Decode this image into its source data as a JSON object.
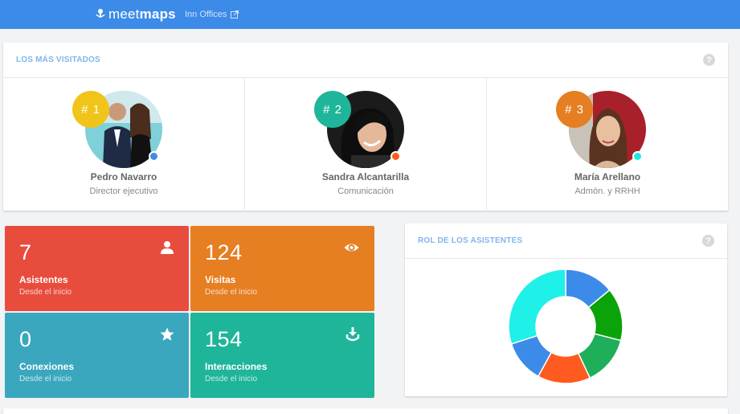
{
  "header": {
    "brand_light": "meet",
    "brand_bold": "maps",
    "event_name": "Inn Offices",
    "colors": {
      "bar": "#3d8be8"
    }
  },
  "most_visited": {
    "title": "LOS MÁS VISITADOS",
    "help": "?",
    "people": [
      {
        "rank": "# 1",
        "name": "Pedro Navarro",
        "role": "Director ejecutivo",
        "rank_color": "#f0c419",
        "status_color": "#3d8be8"
      },
      {
        "rank": "# 2",
        "name": "Sandra Alcantarilla",
        "role": "Comunicación",
        "rank_color": "#1fb59a",
        "status_color": "#ff5a1f"
      },
      {
        "rank": "# 3",
        "name": "María Arellano",
        "role": "Admón. y RRHH",
        "rank_color": "#e67e22",
        "status_color": "#1de9e0"
      }
    ]
  },
  "stats": [
    {
      "value": "7",
      "label": "Asistentes",
      "sub": "Desde el inicio",
      "icon": "person-icon",
      "color": "#e84c3d"
    },
    {
      "value": "124",
      "label": "Visitas",
      "sub": "Desde el inicio",
      "icon": "eye-icon",
      "color": "#e67e22"
    },
    {
      "value": "0",
      "label": "Conexiones",
      "sub": "Desde el inicio",
      "icon": "star-icon",
      "color": "#3aa7bf"
    },
    {
      "value": "154",
      "label": "Interacciones",
      "sub": "Desde el inicio",
      "icon": "download-icon",
      "color": "#1fb59a"
    }
  ],
  "roles_card": {
    "title": "ROL DE LOS ASISTENTES",
    "help": "?"
  },
  "chart_data": {
    "type": "pie",
    "title": "",
    "slices": [
      {
        "value": 14,
        "color": "#3d8be8"
      },
      {
        "value": 15,
        "color": "#0aa30a"
      },
      {
        "value": 14,
        "color": "#1fae5a"
      },
      {
        "value": 15,
        "color": "#ff5a1f"
      },
      {
        "value": 12,
        "color": "#3d8be8"
      },
      {
        "value": 30,
        "color": "#1ff0e8"
      }
    ]
  }
}
